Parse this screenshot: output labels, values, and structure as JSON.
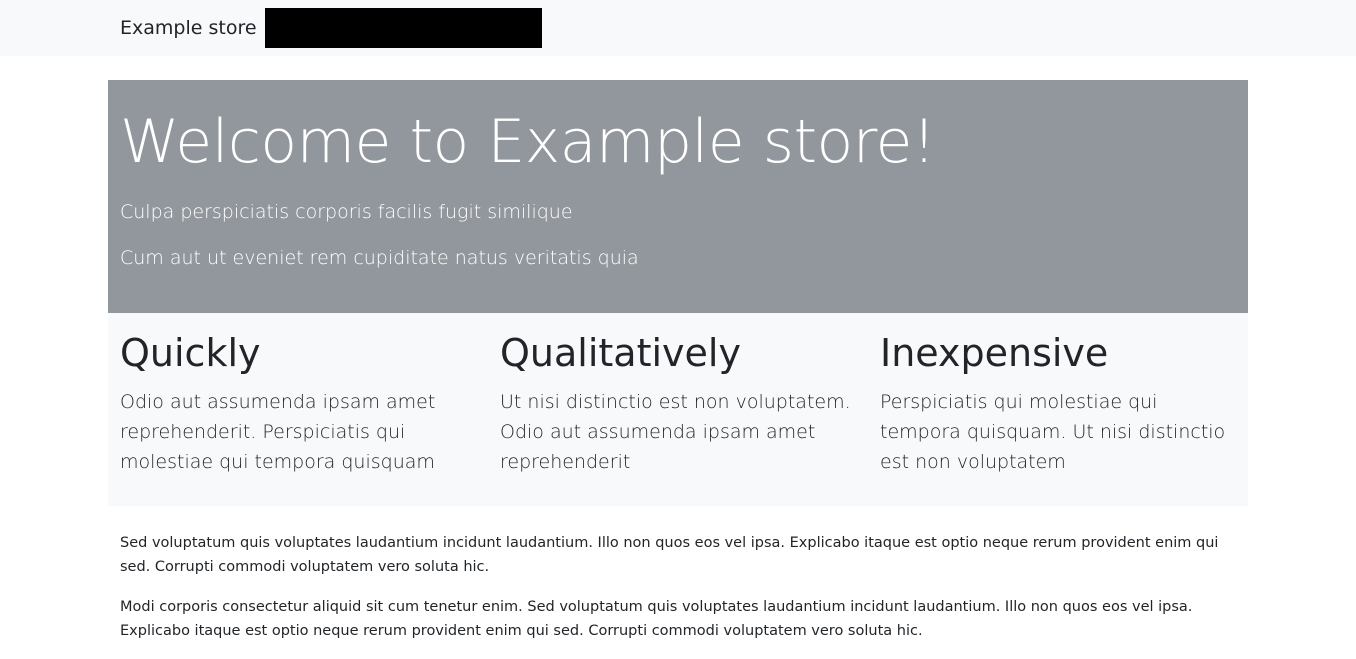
{
  "navbar": {
    "brand": "Example store"
  },
  "hero": {
    "title": "Welcome to Example store!",
    "lines": [
      "Culpa perspiciatis corporis facilis fugit similique",
      "Cum aut ut eveniet rem cupiditate natus veritatis quia"
    ]
  },
  "features": [
    {
      "title": "Quickly",
      "text": "Odio aut assumenda ipsam amet reprehenderit. Perspiciatis qui molestiae qui tempora quisquam"
    },
    {
      "title": "Qualitatively",
      "text": "Ut nisi distinctio est non voluptatem. Odio aut assumenda ipsam amet reprehenderit"
    },
    {
      "title": "Inexpensive",
      "text": "Perspiciatis qui molestiae qui tempora quisquam. Ut nisi distinctio est non voluptatem"
    }
  ],
  "paragraphs": [
    "Sed voluptatum quis voluptates laudantium incidunt laudantium. Illo non quos eos vel ipsa. Explicabo itaque est optio neque rerum provident enim qui sed. Corrupti commodi voluptatem vero soluta hic.",
    "Modi corporis consectetur aliquid sit cum tenetur enim. Sed voluptatum quis voluptates laudantium incidunt laudantium. Illo non quos eos vel ipsa. Explicabo itaque est optio neque rerum provident enim qui sed. Corrupti commodi voluptatem vero soluta hic."
  ]
}
